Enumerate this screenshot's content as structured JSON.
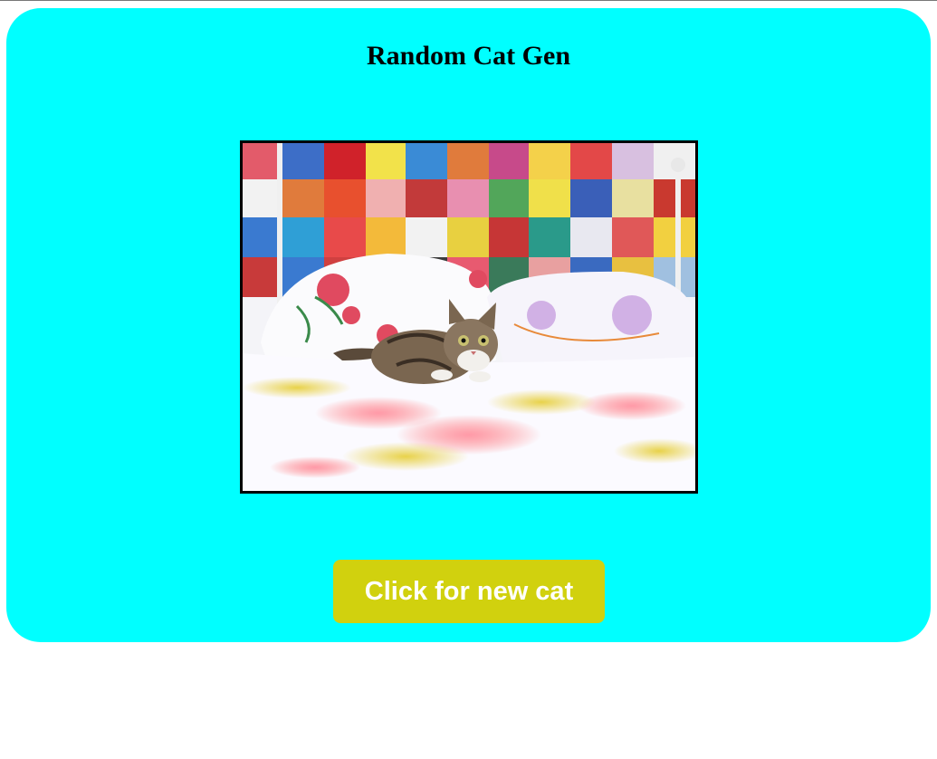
{
  "page": {
    "title": "Random Cat Gen",
    "accent_color": "#00ffff",
    "button_color": "#d1d10e"
  },
  "image": {
    "alt": "cat"
  },
  "button": {
    "label": "Click for new cat"
  }
}
